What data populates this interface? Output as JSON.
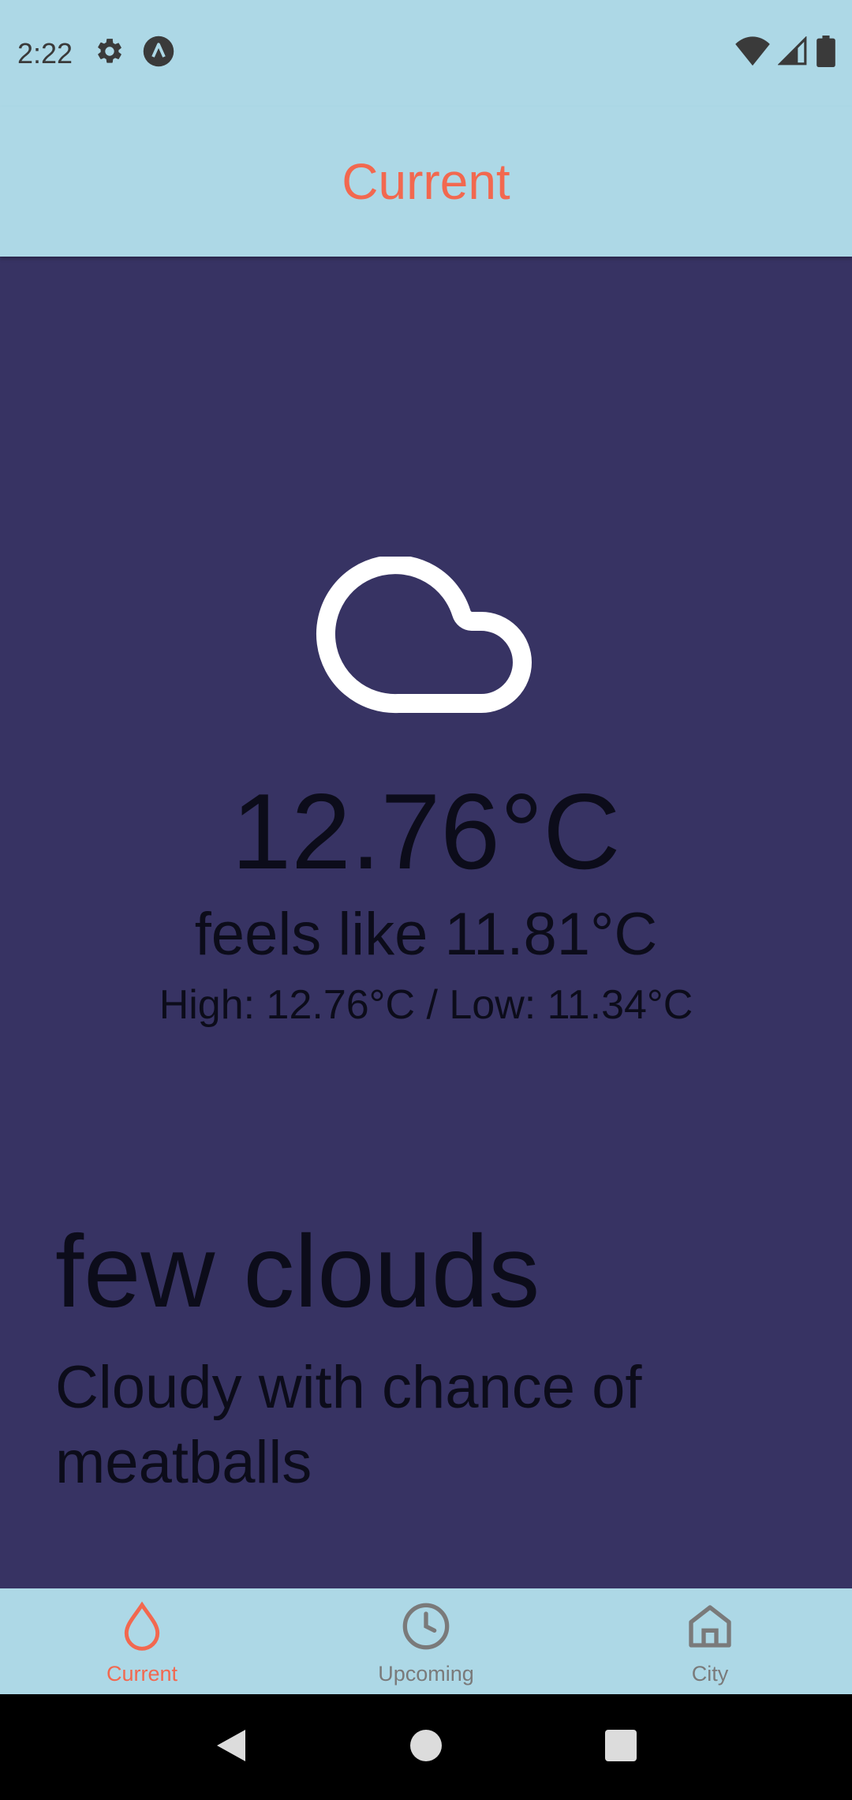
{
  "status_bar": {
    "time": "2:22",
    "icons_left": [
      "gear-icon",
      "app-a-icon"
    ],
    "icons_right": [
      "wifi-icon",
      "signal-icon",
      "battery-icon"
    ]
  },
  "header": {
    "title": "Current"
  },
  "weather": {
    "icon": "cloud-icon",
    "temperature": "12.76°C",
    "feels_like": "feels like 11.81°C",
    "high": "High: 12.76°C",
    "separator": " / ",
    "low": "Low: 11.34°C",
    "description": "few clouds",
    "detail": "Cloudy with chance of meatballs"
  },
  "bottom_nav": {
    "items": [
      {
        "label": "Current",
        "icon": "drop-icon",
        "active": true
      },
      {
        "label": "Upcoming",
        "icon": "clock-icon",
        "active": false
      },
      {
        "label": "City",
        "icon": "home-icon",
        "active": false
      }
    ]
  },
  "colors": {
    "accent": "#F2684F",
    "bar_bg": "#ADD8E6",
    "main_bg": "#373363",
    "inactive": "#7a7a7a"
  }
}
